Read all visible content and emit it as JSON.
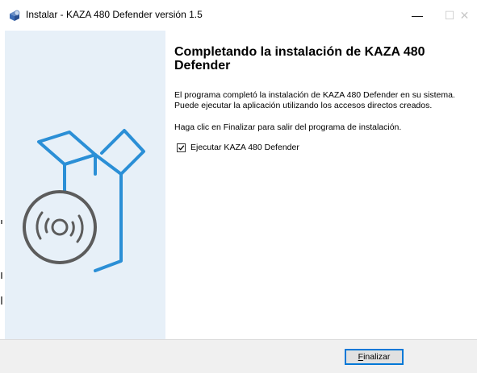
{
  "window": {
    "title": "Instalar - KAZA 480 Defender versión 1.5",
    "minimize_glyph": "—",
    "maximize_glyph": "☐",
    "close_glyph": "✕"
  },
  "page": {
    "heading": "Completando la instalación de KAZA 480 Defender",
    "paragraph1": "El programa completó la instalación de KAZA 480 Defender en su sistema. Puede ejecutar la aplicación utilizando los accesos directos creados.",
    "paragraph2": "Haga clic en Finalizar para salir del programa de instalación.",
    "checkbox": {
      "label": "Ejecutar KAZA 480 Defender",
      "checked": true
    }
  },
  "buttons": {
    "finish_accel": "F",
    "finish_rest": "inalizar"
  },
  "icons": {
    "title_icon": "installer-icon",
    "side_art": "software-box-with-disc-illustration"
  },
  "colors": {
    "side_panel": "#e7f0f8",
    "art_blue": "#2b8fd6",
    "button_focus": "#0078d7"
  }
}
